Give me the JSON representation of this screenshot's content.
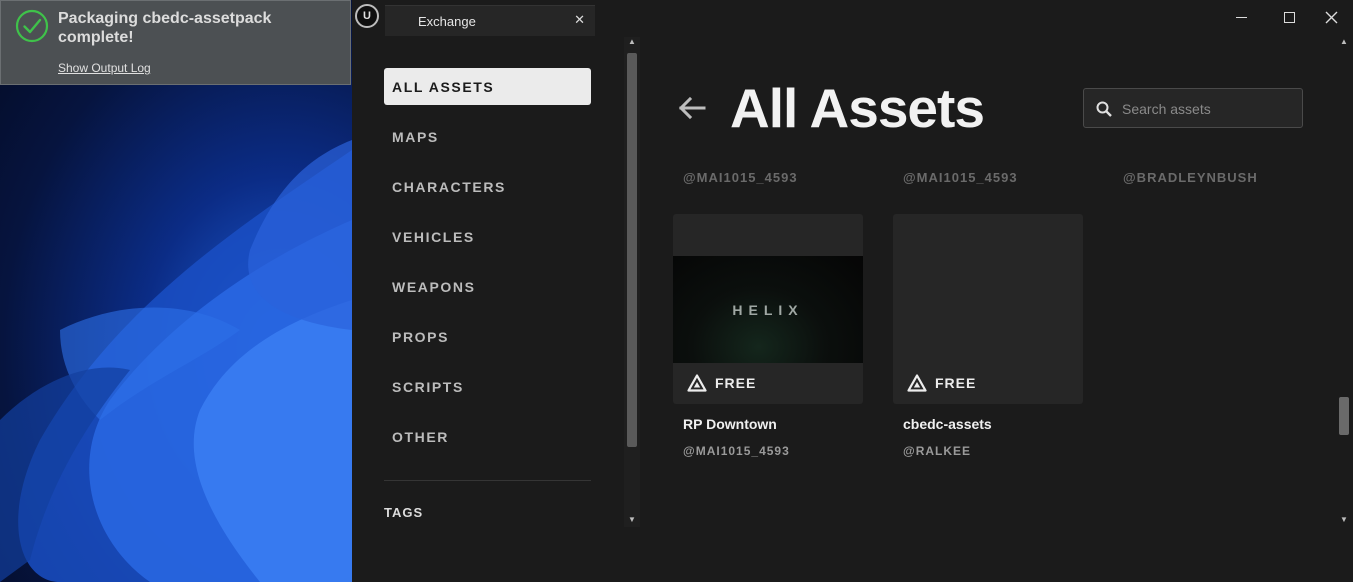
{
  "notification": {
    "message": "Packaging cbedc-assetpack complete!",
    "link": "Show Output Log"
  },
  "window": {
    "tab_label": "Exchange",
    "logo_text": "U"
  },
  "sidebar": {
    "categories": [
      {
        "label": "ALL ASSETS",
        "active": true
      },
      {
        "label": "MAPS"
      },
      {
        "label": "CHARACTERS"
      },
      {
        "label": "VEHICLES"
      },
      {
        "label": "WEAPONS"
      },
      {
        "label": "PROPS"
      },
      {
        "label": "SCRIPTS"
      },
      {
        "label": "OTHER"
      }
    ],
    "tags_label": "TAGS"
  },
  "main": {
    "title": "All Assets",
    "search_placeholder": "Search assets",
    "cutoff_authors": [
      "@MAI1015_4593",
      "@MAI1015_4593",
      "@BRADLEYNBUSH"
    ],
    "cards": [
      {
        "name": "RP Downtown",
        "author": "@MAI1015_4593",
        "price": "FREE",
        "thumb_text": "HELIX"
      },
      {
        "name": "cbedc-assets",
        "author": "@RALKEE",
        "price": "FREE"
      }
    ]
  },
  "colors": {
    "background": "#1b1b1b",
    "card": "#262626",
    "active_item": "#ebebeb",
    "success_green": "#3fc24a"
  }
}
